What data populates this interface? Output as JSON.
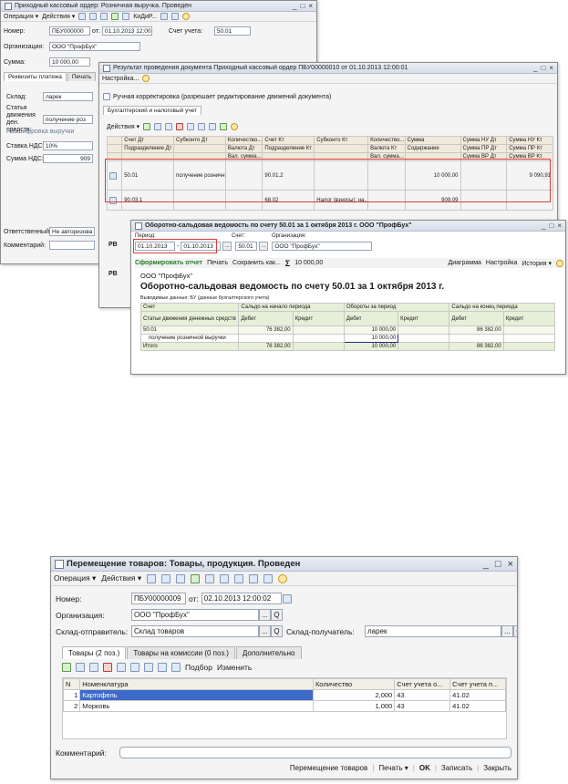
{
  "w1": {
    "title": "Приходный кассовый ордер: Розничная выручка. Проведен",
    "menu": [
      "Операция ▾",
      "Действия ▾",
      "КиДиР..."
    ],
    "number_label": "Номер:",
    "number_value": "ПБУ000000",
    "from_label": "от:",
    "date_value": "01.10.2013 12:00",
    "account_label": "Счет учета:",
    "account_value": "50.01",
    "org_label": "Организация:",
    "org_value": "ООО \"ПрофБух\"",
    "sum_label": "Сумма:",
    "sum_value": "10 000,00",
    "tabs": [
      "Реквизиты платежа",
      "Печать"
    ],
    "warehouse_label": "Склад:",
    "warehouse_value": "ларек",
    "cash_item_label": "Статья движения ден. средств:",
    "cash_item_value": "получение роз",
    "breakdown_label": "Расшифровка выручки",
    "vat_rate_label": "Ставка НДС:",
    "vat_rate_value": "10%",
    "vat_sum_label": "Сумма НДС:",
    "vat_sum_value": "909",
    "responsible_label": "Ответственный:",
    "responsible_value": "Не авторизова",
    "comment_label": "Комментарий:"
  },
  "w2": {
    "title": "Результат проведения документа Приходный кассовый ордер ПБУ00000010 от 01.10.2013 12:00:01",
    "settings_label": "Настройка...",
    "manual_label": "Ручная корректировка (разрешает редактирование движений документа)",
    "tab_label": "Бухгалтерский и налоговый учет",
    "actions_label": "Действия ▾",
    "headers_row1": [
      "",
      "Счет Дт",
      "Субконто Дт",
      "Количество...",
      "Счет Кт",
      "Субконто Кт",
      "Количество...",
      "Сумма",
      "Сумма НУ Дт",
      "Сумма НУ Кт"
    ],
    "headers_row2": [
      "",
      "Подразделение Дт",
      "",
      "Валюта Дт",
      "Подразделение Кт",
      "",
      "Валюта Кт",
      "Содержание",
      "Сумма ПР Дт",
      "Сумма ПР Кт"
    ],
    "headers_row3": [
      "",
      "",
      "",
      "Вал. сумма...",
      "",
      "",
      "Вал. сумма...",
      "",
      "Сумма ВР Дт",
      "Сумма ВР Кт"
    ],
    "row1": [
      "50.01",
      "получение розничн...",
      "",
      "90.01.2",
      "",
      "",
      "10 000,00",
      "",
      "9 090,91"
    ],
    "row2": [
      "90.03.1",
      "",
      "",
      "68.02",
      "Налог (взносы): на...",
      "",
      "909,09",
      "",
      ""
    ],
    "left_labels": [
      "РВ",
      "РВ"
    ]
  },
  "w3": {
    "title": "Оборотно-сальдовая ведомость по счету 50.01 за 1 октября 2013 г. ООО \"ПрофБух\"",
    "period_label": "Период:",
    "period_from": "01.10.2013",
    "period_to": "01.10.2013",
    "account_label": "Счет:",
    "account_value": "50.01",
    "org_label": "Организация:",
    "org_value": "ООО \"ПрофБух\"",
    "form_btn": "Сформировать отчет",
    "print_btn": "Печать",
    "save_btn": "Сохранить как...",
    "sigma_value": "10 000,00",
    "diagram_btn": "Диаграмма",
    "settings_btn": "Настройка",
    "history_btn": "История ▾",
    "company": "ООО \"ПрофБух\"",
    "report_title": "Оборотно-сальдовая ведомость по счету 50.01 за 1 октября 2013 г.",
    "output_data": "Выводимые данные:  БУ (данные бухгалтерского учета)",
    "hdr_account": "Счет",
    "hdr_start": "Сальдо на начало периода",
    "hdr_turn": "Обороты за период",
    "hdr_end": "Сальдо на конец периода",
    "hdr_item": "Статьи движения денежных средств",
    "debit": "Дебет",
    "credit": "Кредит",
    "r1": [
      "50.01",
      "76 382,00",
      "",
      "10 000,00",
      "",
      "86 382,00",
      ""
    ],
    "r2": [
      "получение розничной выручки",
      "",
      "",
      "10 000,00",
      "",
      "",
      ""
    ],
    "r3": [
      "Итого",
      "76 382,00",
      "",
      "10 000,00",
      "",
      "86 382,00",
      ""
    ]
  },
  "w4": {
    "title": "Перемещение товаров: Товары, продукция. Проведен",
    "menu_op": "Операция ▾",
    "menu_actions": "Действия ▾",
    "number_label": "Номер:",
    "number_value": "ПБУ00000009",
    "from_label": "от:",
    "date_value": "02.10.2013 12:00:02",
    "org_label": "Организация:",
    "org_value": "ООО \"ПрофБух\"",
    "src_label": "Склад-отправитель:",
    "src_value": "Склад товаров",
    "dst_label": "Склад-получатель:",
    "dst_value": "ларек",
    "tabs": [
      "Товары (2 поз.)",
      "Товары на комиссии (0 поз.)",
      "Дополнительно"
    ],
    "pick_label": "Подбор",
    "change_label": "Изменить",
    "col_n": "N",
    "col_nom": "Номенклатура",
    "col_qty": "Количество",
    "col_acc_o": "Счет учета о...",
    "col_acc_p": "Счет учета п...",
    "rows": [
      {
        "n": "1",
        "name": "Картофель",
        "qty": "2,000",
        "acc_o": "43",
        "acc_p": "41.02"
      },
      {
        "n": "2",
        "name": "Морковь",
        "qty": "1,000",
        "acc_o": "43",
        "acc_p": "41.02"
      }
    ],
    "comment_label": "Комментарий:",
    "footer_move": "Перемещение товаров",
    "footer_print": "Печать ▾",
    "footer_ok": "OK",
    "footer_save": "Записать",
    "footer_close": "Закрыть"
  }
}
